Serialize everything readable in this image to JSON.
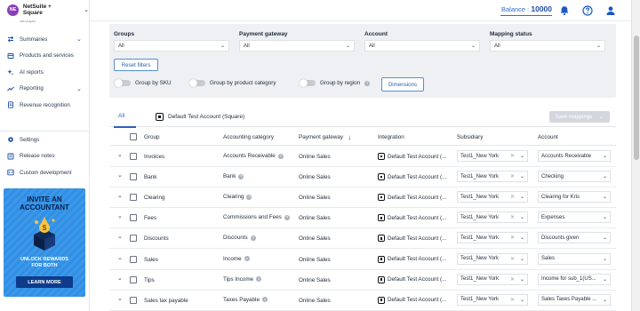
{
  "org": {
    "initials": "NE",
    "name": "NetSuite + Square",
    "clipped_item": "Groups"
  },
  "nav": [
    {
      "label": "Summaries",
      "icon": "arrows-icon",
      "has_chevron": true
    },
    {
      "label": "Products and services",
      "icon": "product-icon",
      "has_chevron": false
    },
    {
      "label": "AI reports",
      "icon": "sparkle-icon",
      "has_chevron": false
    },
    {
      "label": "Reporting",
      "icon": "chart-icon",
      "has_chevron": true
    },
    {
      "label": "Revenue recognition",
      "icon": "document-icon",
      "has_chevron": false
    }
  ],
  "nav2": [
    {
      "label": "Settings",
      "icon": "gear-icon"
    },
    {
      "label": "Release notes",
      "icon": "notes-icon"
    },
    {
      "label": "Custom development",
      "icon": "code-icon"
    }
  ],
  "promo": {
    "title_line1": "INVITE AN",
    "title_line2": "ACCOUNTANT",
    "sub_line1": "UNLOCK REWARDS",
    "sub_line2": "FOR BOTH",
    "button": "LEARN MORE"
  },
  "header": {
    "balance_label": "Balance : ",
    "balance_value": "10000"
  },
  "filters": {
    "groups": {
      "label": "Groups",
      "value": "All"
    },
    "payment_gateway": {
      "label": "Payment gateway",
      "value": "All"
    },
    "account": {
      "label": "Account",
      "value": "All"
    },
    "mapping_status": {
      "label": "Mapping status",
      "value": "All"
    },
    "reset": "Reset filters",
    "group_by_sku": "Group by SKU",
    "group_by_category": "Group by product category",
    "group_by_region": "Group by region",
    "dimensions": "Dimensions"
  },
  "tabs": {
    "all": "All",
    "account": "Default Test Account (Square)",
    "save_mappings": "Save mappings"
  },
  "columns": {
    "group": "Group",
    "accounting_category": "Accounting category",
    "payment_gateway": "Payment gateway",
    "integration": "Integration",
    "subsidiary": "Subsidiary",
    "account": "Account"
  },
  "rows": [
    {
      "group": "Invoices",
      "category": "Accounts Receivable",
      "gateway": "Online Sales",
      "integration": "Default Test Account (...",
      "subsidiary": "Test1_New York",
      "account": "Accounts Receivable"
    },
    {
      "group": "Bank",
      "category": "Bank",
      "gateway": "Online Sales",
      "integration": "Default Test Account (...",
      "subsidiary": "Test1_New York",
      "account": "Checking"
    },
    {
      "group": "Clearing",
      "category": "Clearing",
      "gateway": "Online Sales",
      "integration": "Default Test Account (...",
      "subsidiary": "Test1_New York",
      "account": "Clearing for Kris"
    },
    {
      "group": "Fees",
      "category": "Commissions and Fees",
      "gateway": "Online Sales",
      "integration": "Default Test Account (...",
      "subsidiary": "Test1_New York",
      "account": "Expenses"
    },
    {
      "group": "Discounts",
      "category": "Discounts",
      "gateway": "Online Sales",
      "integration": "Default Test Account (...",
      "subsidiary": "Test1_New York",
      "account": "Discounts given"
    },
    {
      "group": "Sales",
      "category": "Income",
      "gateway": "Online Sales",
      "integration": "Default Test Account (...",
      "subsidiary": "Test1_New York",
      "account": "Sales"
    },
    {
      "group": "Tips",
      "category": "Tips Income",
      "gateway": "Online Sales",
      "integration": "Default Test Account (...",
      "subsidiary": "Test1_New York",
      "account": "Income for sub_1(US..."
    },
    {
      "group": "Sales tax payable",
      "category": "Taxes Payable",
      "gateway": "Online Sales",
      "integration": "Default Test Account (...",
      "subsidiary": "Test1_New York",
      "account": "Sales Taxes Payable ..."
    }
  ]
}
